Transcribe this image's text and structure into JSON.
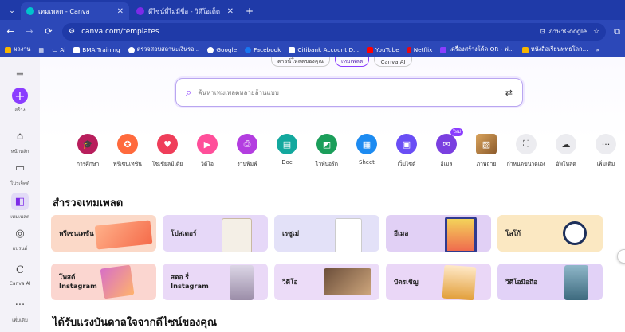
{
  "browser": {
    "tabs": [
      {
        "title": "เทมเพลต - Canva",
        "active": true,
        "favicon_color": "#00c4cc"
      },
      {
        "title": "ดีไซน์ที่ไม่มีชื่อ - วิดีโอเด็ด",
        "active": false,
        "favicon_color": "#7d2ae8"
      }
    ],
    "url": "canva.com/templates",
    "translate_label": "ภาษาGoogle",
    "bookmarks": [
      {
        "label": "ผลงาน",
        "color": "#f7b500"
      },
      {
        "label": "",
        "color": "#ffffff"
      },
      {
        "label": "Ai",
        "color": "#ffffff"
      },
      {
        "label": "BMA Training",
        "color": "#ffffff"
      },
      {
        "label": "ตรวจสอบสถานะเงินรอ...",
        "color": "#ffffff"
      },
      {
        "label": "Google",
        "color": "#ffffff"
      },
      {
        "label": "Facebook",
        "color": "#1877f2"
      },
      {
        "label": "Citibank Account D...",
        "color": "#ffffff"
      },
      {
        "label": "YouTube",
        "color": "#ff0000"
      },
      {
        "label": "Netflix",
        "color": "#e50914"
      },
      {
        "label": "เครื่องสร้างโค้ด QR - ฟ...",
        "color": "#8b3dff"
      },
      {
        "label": "หนังสือเรียนพุทธโลก...",
        "color": "#f7b500"
      }
    ]
  },
  "sidebar": {
    "items": [
      {
        "label": "สร้าง",
        "icon": "plus-icon"
      },
      {
        "label": "หน้าหลัก",
        "icon": "home-icon"
      },
      {
        "label": "โปรเจ็คต์",
        "icon": "folder-icon"
      },
      {
        "label": "เทมเพลต",
        "icon": "templates-icon"
      },
      {
        "label": "แบรนด์",
        "icon": "brand-icon"
      },
      {
        "label": "Canva AI",
        "icon": "canva-ai-icon"
      },
      {
        "label": "เพิ่มเติม",
        "icon": "more-icon"
      }
    ]
  },
  "top_tabs": [
    "ดาวน์โหลดของคุณ",
    "เทมเพลต",
    "Canva AI"
  ],
  "search": {
    "placeholder": "ค้นหาเทมเพลตหลายล้านแบบ"
  },
  "categories": [
    {
      "label": "การศึกษา",
      "color": "#b81e5c",
      "icon": "education-icon"
    },
    {
      "label": "พรีเซนเทชัน",
      "color": "#ff6a3d",
      "icon": "presentation-icon"
    },
    {
      "label": "โซเชียลมีเดีย",
      "color": "#ef3e5a",
      "icon": "social-media-icon"
    },
    {
      "label": "วิดีโอ",
      "color": "#ff4f9a",
      "icon": "video-icon"
    },
    {
      "label": "งานพิมพ์",
      "color": "#b33de0",
      "icon": "print-icon"
    },
    {
      "label": "Doc",
      "color": "#13a89e",
      "icon": "doc-icon"
    },
    {
      "label": "ไวท์บอร์ด",
      "color": "#1b9e5a",
      "icon": "whiteboard-icon"
    },
    {
      "label": "Sheet",
      "color": "#1d8bf1",
      "icon": "sheet-icon"
    },
    {
      "label": "เว็บไซต์",
      "color": "#6a4ef5",
      "icon": "website-icon"
    },
    {
      "label": "อีเมล",
      "color": "#7a3fe0",
      "icon": "email-icon",
      "badge": "ใหม่"
    },
    {
      "label": "ภาพถ่าย",
      "color": "#c98a4a",
      "icon": "photo-icon"
    },
    {
      "label": "กำหนดขนาดเอง",
      "color": "#ececf0",
      "icon": "custom-size-icon"
    },
    {
      "label": "อัพโหลด",
      "color": "#ececf0",
      "icon": "upload-icon"
    },
    {
      "label": "เพิ่มเติม",
      "color": "#ececf0",
      "icon": "more-icon"
    }
  ],
  "explore": {
    "title": "สำรวจเทมเพลต",
    "tiles": [
      {
        "label": "พรีเซนเทชัน",
        "bg": "#fbd9c8"
      },
      {
        "label": "โปสเตอร์",
        "bg": "#e6d8f8"
      },
      {
        "label": "เรซูเม่",
        "bg": "#e3e1f8"
      },
      {
        "label": "อีเมล",
        "bg": "#e1d0f5"
      },
      {
        "label": "โลโก้",
        "bg": "#fbe8c2"
      },
      {
        "label": "โพสต์ Instagram",
        "bg": "#fbd6d0"
      },
      {
        "label": "สตอ รี่ Instagram",
        "bg": "#ead9f7"
      },
      {
        "label": "วิดีโอ",
        "bg": "#ecdcf8"
      },
      {
        "label": "บัตรเชิญ",
        "bg": "#ead7f7"
      },
      {
        "label": "วิดีโอมือถือ",
        "bg": "#e2d2f7"
      }
    ]
  },
  "inspiration": {
    "title": "ได้รับแรงบันดาลใจจากดีไซน์ของคุณ"
  }
}
